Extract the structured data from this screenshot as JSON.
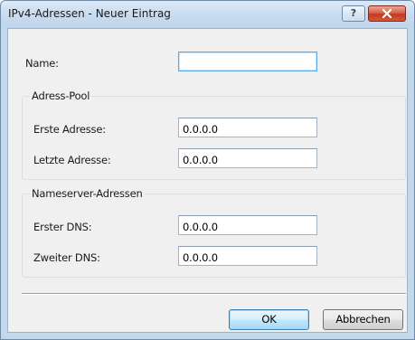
{
  "window": {
    "title": "IPv4-Adressen - Neuer Eintrag",
    "help_label": "?"
  },
  "form": {
    "name_label": "Name:",
    "name_value": ""
  },
  "address_pool": {
    "caption": "Adress-Pool",
    "first_label": "Erste Adresse:",
    "first_value": "0.0.0.0",
    "last_label": "Letzte Adresse:",
    "last_value": "0.0.0.0"
  },
  "nameserver": {
    "caption": "Nameserver-Adressen",
    "dns1_label": "Erster DNS:",
    "dns1_value": "0.0.0.0",
    "dns2_label": "Zweiter DNS:",
    "dns2_value": "0.0.0.0"
  },
  "buttons": {
    "ok": "OK",
    "cancel": "Abbrechen"
  },
  "colors": {
    "titlebar": "#c9dcf0",
    "close_button": "#c3391f",
    "client_bg": "#f0f0f0",
    "focus_border": "#5aa8e6"
  }
}
